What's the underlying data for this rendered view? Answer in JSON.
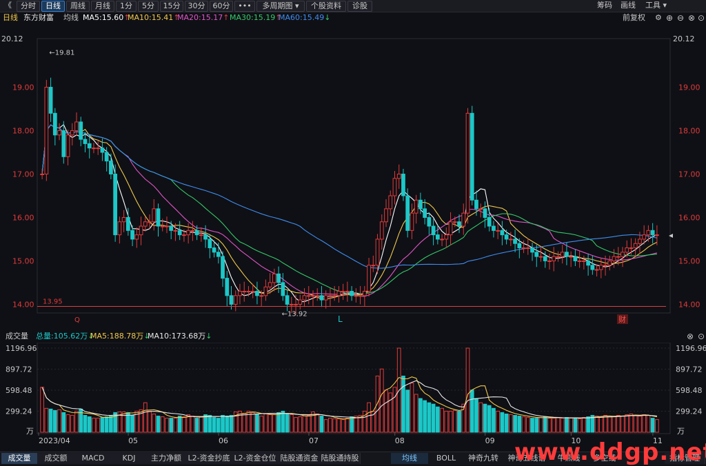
{
  "toolbar": {
    "back": "《",
    "buttons": [
      "分时",
      "日线",
      "周线",
      "月线",
      "1分",
      "5分",
      "15分",
      "30分",
      "60分",
      "•••",
      "多周期图 ▾",
      "个股资料",
      "诊股"
    ],
    "active_index": 1,
    "right": [
      "筹码",
      "画线",
      "工具 ▾"
    ]
  },
  "info": {
    "period": "日线",
    "name": "东方财富",
    "ma_label": "均线",
    "ma5": "MA5:15.60",
    "ma10": "MA10:15.41",
    "ma20": "MA20:15.17",
    "ma30": "MA30:15.19",
    "ma60": "MA60:15.49",
    "fq": "前复权",
    "colors": {
      "ma5": "#ffffff",
      "ma10": "#f2c94c",
      "ma20": "#e055c8",
      "ma30": "#35c96a",
      "ma60": "#3f8df0",
      "up": "#e03b3b",
      "down": "#1cc8c8"
    }
  },
  "price_axis": {
    "top_label": "20.12",
    "ticks": [
      "19.00",
      "18.00",
      "17.00",
      "16.00",
      "15.00",
      "14.00"
    ],
    "high_mark": "19.81",
    "low_mark": "13.92",
    "support": "13.95",
    "marker_l": "L",
    "marker_q": "Q",
    "marker_cai": "财"
  },
  "volume": {
    "title": "成交量",
    "total": "总量:105.62万",
    "ma5": "MA5:188.78万",
    "ma10": "MA10:173.68万",
    "ticks": [
      "1196.96",
      "897.72",
      "598.48",
      "299.24"
    ],
    "unit": "万"
  },
  "x_axis": {
    "labels": [
      "2023/04",
      "05",
      "06",
      "07",
      "08",
      "09",
      "10",
      "11"
    ]
  },
  "bottom_tabs": [
    "成交量",
    "成交额",
    "MACD",
    "KDJ",
    "主力净额",
    "L2-资金抄底",
    "L2-资金仓位",
    "陆股通资金",
    "陆股通持股"
  ],
  "bottom_tabs2": [
    "均线",
    "BOLL",
    "神奇九转",
    "神奇五线谱",
    "牛熊线",
    "多空线"
  ],
  "bottom_right": "指标管理",
  "watermark": "www.ddgp.net",
  "chart_data": {
    "type": "candlestick",
    "closes": [
      17.0,
      19.0,
      18.4,
      17.9,
      18.0,
      17.4,
      17.9,
      18.0,
      18.2,
      17.8,
      17.7,
      17.6,
      17.6,
      17.6,
      17.5,
      17.3,
      17.0,
      15.6,
      15.9,
      16.0,
      15.7,
      15.5,
      15.6,
      15.8,
      15.9,
      15.9,
      16.2,
      15.8,
      15.8,
      15.8,
      15.7,
      15.7,
      15.6,
      15.6,
      15.7,
      15.7,
      15.6,
      15.6,
      15.5,
      15.3,
      15.2,
      15.1,
      14.6,
      14.2,
      14.0,
      14.2,
      14.3,
      14.3,
      14.3,
      14.3,
      14.2,
      14.2,
      14.4,
      14.5,
      14.7,
      14.5,
      14.2,
      14.0,
      14.0,
      14.0,
      14.1,
      14.2,
      14.2,
      14.2,
      14.2,
      14.1,
      14.2,
      14.2,
      14.2,
      14.3,
      14.3,
      14.3,
      14.2,
      14.2,
      14.2,
      14.3,
      14.9,
      14.9,
      15.5,
      15.9,
      16.2,
      16.5,
      16.9,
      17.0,
      16.5,
      15.7,
      16.1,
      16.4,
      16.2,
      16.0,
      15.8,
      15.6,
      15.5,
      15.5,
      15.6,
      15.9,
      15.9,
      15.8,
      16.1,
      18.4,
      16.4,
      16.2,
      16.2,
      16.0,
      15.8,
      15.7,
      15.7,
      15.6,
      15.5,
      15.5,
      15.4,
      15.3,
      15.3,
      15.3,
      15.2,
      15.1,
      15.1,
      15.0,
      15.0,
      15.1,
      15.1,
      15.2,
      15.1,
      15.1,
      15.0,
      15.0,
      15.0,
      14.9,
      14.8,
      14.8,
      14.9,
      14.9,
      15.0,
      15.1,
      15.1,
      15.2,
      15.3,
      15.3,
      15.4,
      15.5,
      15.6,
      15.7,
      15.6,
      15.6
    ],
    "high": 19.81,
    "low": 13.92,
    "ylim": [
      13.8,
      20.12
    ],
    "volume_ylim": [
      0,
      1196.96
    ],
    "series": [
      {
        "name": "MA5",
        "value": 15.6
      },
      {
        "name": "MA10",
        "value": 15.41
      },
      {
        "name": "MA20",
        "value": 15.17
      },
      {
        "name": "MA30",
        "value": 15.19
      },
      {
        "name": "MA60",
        "value": 15.49
      }
    ],
    "volume_values": [
      640,
      340,
      330,
      310,
      320,
      280,
      250,
      240,
      300,
      330,
      240,
      220,
      200,
      200,
      210,
      220,
      230,
      280,
      290,
      290,
      280,
      240,
      300,
      320,
      420,
      300,
      260,
      230,
      220,
      200,
      200,
      200,
      230,
      220,
      250,
      230,
      200,
      220,
      250,
      240,
      210,
      200,
      240,
      230,
      240,
      290,
      300,
      270,
      300,
      280,
      260,
      230,
      260,
      250,
      250,
      280,
      300,
      260,
      250,
      210,
      220,
      230,
      240,
      290,
      260,
      230,
      180,
      200,
      190,
      190,
      180,
      200,
      220,
      230,
      240,
      300,
      420,
      300,
      800,
      900,
      600,
      560,
      640,
      1200,
      800,
      600,
      700,
      540,
      480,
      450,
      420,
      400,
      360,
      340,
      300,
      300,
      310,
      300,
      400,
      1400,
      600,
      480,
      420,
      400,
      380,
      340,
      300,
      280,
      260,
      250,
      240,
      230,
      220,
      210,
      200,
      200,
      210,
      220,
      200,
      200,
      210,
      200,
      210,
      200,
      200,
      190,
      210,
      220,
      240,
      230,
      220,
      240,
      230,
      220,
      240,
      230,
      250,
      260,
      240,
      230,
      250,
      240,
      200,
      180
    ]
  }
}
